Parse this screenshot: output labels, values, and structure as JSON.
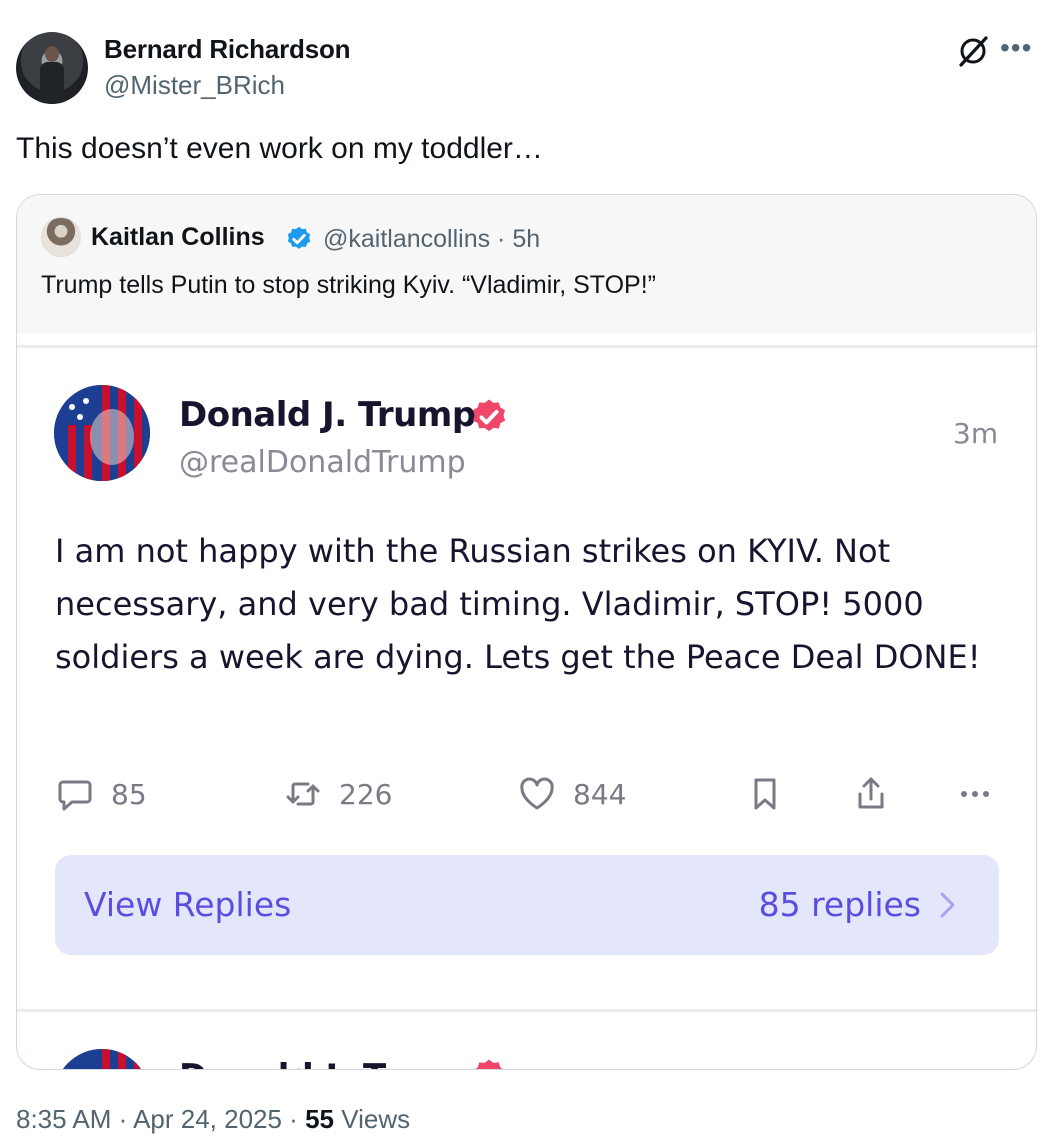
{
  "author": {
    "name": "Bernard Richardson",
    "handle": "@Mister_BRich"
  },
  "tweet": {
    "text": "This doesn’t even work on my toddler…"
  },
  "quote": {
    "name": "Kaitlan Collins",
    "handle_time": "@kaitlancollins · 5h",
    "text": "Trump tells Putin to stop striking Kyiv. “Vladimir, STOP!”"
  },
  "truth_post": {
    "name": "Donald J. Trump",
    "handle": "@realDonaldTrump",
    "time": "3m",
    "body": "I am not happy with the Russian strikes on KYIV. Not necessary, and very bad timing. Vladimir, STOP! 5000 soldiers a week are dying. Lets get the Peace Deal DONE!",
    "replies": "85",
    "retruths": "226",
    "likes": "844",
    "view_replies_label": "View Replies",
    "replies_count_label": "85 replies",
    "verified_color": "#f0466a",
    "accent": "#5a4ee0"
  },
  "footer": {
    "time_date": "8:35 AM · Apr 24, 2025 · ",
    "views_count": "55",
    "views_label": " Views"
  },
  "colors": {
    "x_verified": "#1d9bf0",
    "muted": "#536471"
  }
}
